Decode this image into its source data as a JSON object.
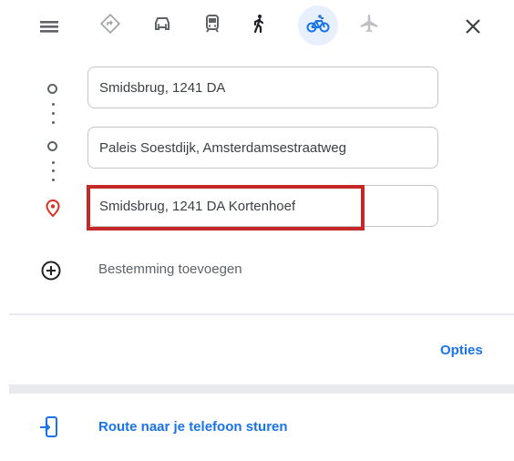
{
  "toolbar": {
    "modes": [
      {
        "name": "best-route",
        "icon": "diamond-directions-icon"
      },
      {
        "name": "driving",
        "icon": "car-icon"
      },
      {
        "name": "transit",
        "icon": "train-icon"
      },
      {
        "name": "walking",
        "icon": "walking-icon"
      },
      {
        "name": "cycling",
        "icon": "bicycle-icon",
        "selected": true
      },
      {
        "name": "flights",
        "icon": "airplane-icon"
      }
    ]
  },
  "waypoints": [
    {
      "value": "Smidsbrug, 1241 DA"
    },
    {
      "value": "Paleis Soestdijk, Amsterdamsestraatweg"
    },
    {
      "value": "Smidsbrug, 1241 DA Kortenhoef"
    }
  ],
  "add_destination": {
    "label": "Bestemming toevoegen"
  },
  "options": {
    "label": "Opties"
  },
  "send_to_phone": {
    "label": "Route naar je telefoon sturen"
  },
  "colors": {
    "accent": "#1a73e8",
    "highlight": "#c62828",
    "destination_pin": "#d93025"
  }
}
